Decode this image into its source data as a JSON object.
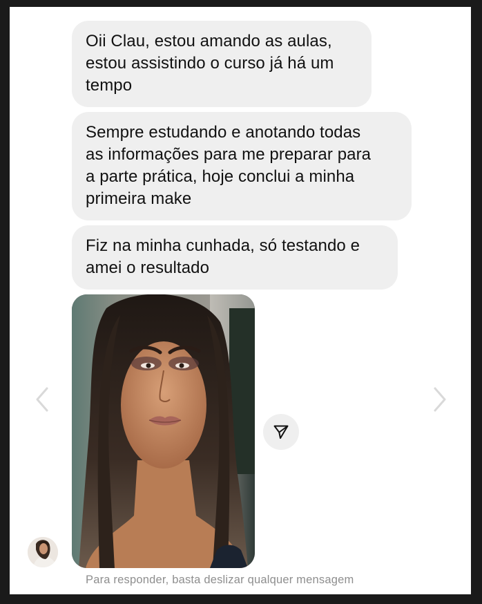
{
  "conversation": {
    "messages": [
      {
        "lines": [
          "Oii Clau, estou amando as aulas,",
          "estou assistindo o curso já há um",
          "tempo"
        ]
      },
      {
        "lines": [
          "Sempre estudando e anotando todas",
          "as informações para me preparar para",
          "a parte prática, hoje conclui a minha",
          "primeira make"
        ]
      },
      {
        "lines": [
          "Fiz na minha cunhada, só testando e",
          "amei o resultado"
        ]
      }
    ],
    "attachment": {
      "type": "photo",
      "subject": "makeup-portrait"
    },
    "share_icon": "paper-plane-icon",
    "avatar_icon": "avatar"
  },
  "navigation": {
    "prev_icon": "chevron-left-icon",
    "next_icon": "chevron-right-icon"
  },
  "footer": {
    "hint": "Para responder, basta deslizar qualquer mensagem"
  },
  "colors": {
    "bubble": "#efefef",
    "text": "#111111",
    "hint": "#8e8e8e",
    "arrow": "#d9d9d9"
  }
}
